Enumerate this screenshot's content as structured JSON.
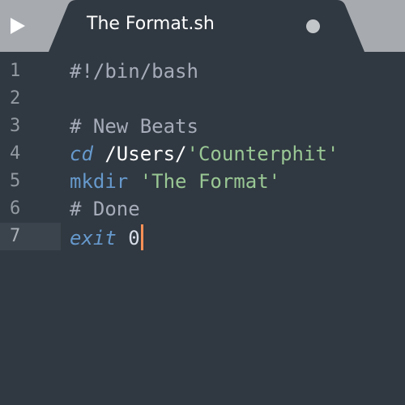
{
  "tab": {
    "title": "The Format.sh"
  },
  "editor": {
    "current_line": 7,
    "lines": [
      {
        "number": "1",
        "tokens": [
          {
            "type": "comment",
            "text": "#!/bin/bash"
          }
        ]
      },
      {
        "number": "2",
        "tokens": []
      },
      {
        "number": "3",
        "tokens": [
          {
            "type": "comment",
            "text": "# New Beats"
          }
        ]
      },
      {
        "number": "4",
        "tokens": [
          {
            "type": "builtin",
            "text": "cd"
          },
          {
            "type": "plain",
            "text": " "
          },
          {
            "type": "path",
            "text": "/Users/"
          },
          {
            "type": "string",
            "text": "'Counterphit'"
          }
        ]
      },
      {
        "number": "5",
        "tokens": [
          {
            "type": "command",
            "text": "mkdir"
          },
          {
            "type": "plain",
            "text": " "
          },
          {
            "type": "string",
            "text": "'The Format'"
          }
        ]
      },
      {
        "number": "6",
        "tokens": [
          {
            "type": "comment",
            "text": "# Done"
          }
        ]
      },
      {
        "number": "7",
        "tokens": [
          {
            "type": "builtin",
            "text": "exit"
          },
          {
            "type": "plain",
            "text": " 0"
          }
        ]
      }
    ]
  },
  "icons": {
    "sidebar_toggle": "play-triangle-icon",
    "unsaved_indicator": "dot-icon"
  },
  "colors": {
    "background": "#303841",
    "tabbar": "#a7abb0",
    "comment": "#a6acb9",
    "keyword": "#6699cc",
    "string": "#99c794",
    "cursor": "#f99157"
  }
}
